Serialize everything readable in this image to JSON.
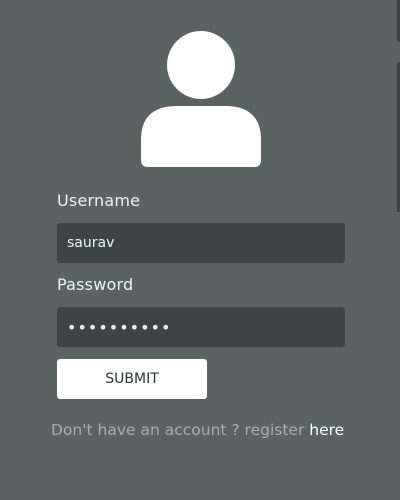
{
  "form": {
    "username_label": "Username",
    "username_value": "saurav",
    "password_label": "Password",
    "password_value": "••••••••••",
    "submit_label": "SUBMIT"
  },
  "footer": {
    "prompt_text": "Don't have an account ? register",
    "link_text": "here"
  },
  "icons": {
    "avatar": "user-avatar-icon"
  },
  "colors": {
    "background": "#5a6262",
    "field_background": "#3c4444",
    "button_background": "#ffffff",
    "label_text": "#f1f3f3",
    "muted_text": "#a7b0b0"
  }
}
